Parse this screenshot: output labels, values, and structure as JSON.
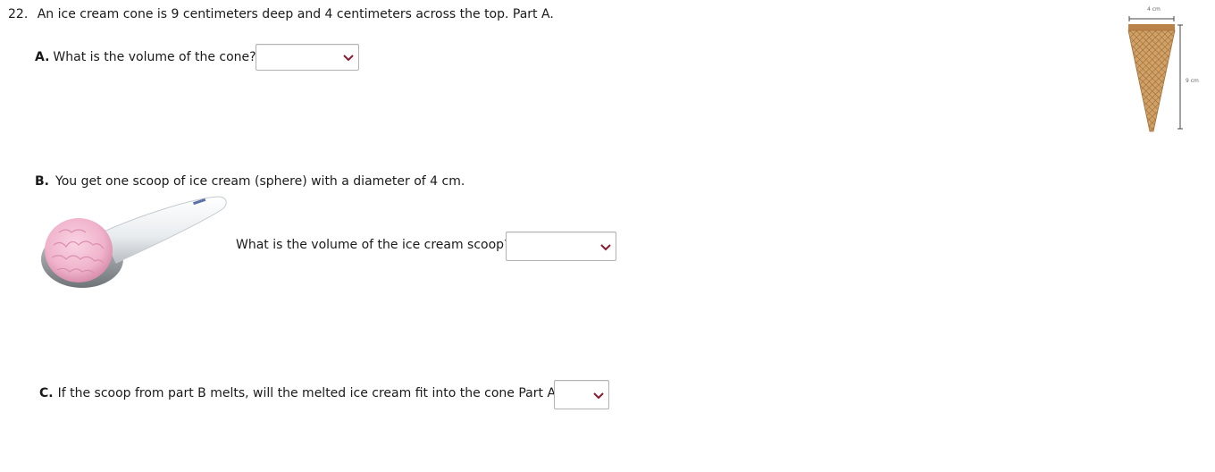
{
  "question": {
    "number": "22.",
    "text": "An ice cream cone is 9 centimeters deep and 4 centimeters across the top. Part A."
  },
  "part_a": {
    "letter": "A.",
    "prompt": "What is the volume of the cone?",
    "dropdown_value": ""
  },
  "part_b": {
    "letter": "B.",
    "prompt": "You get one scoop of ice cream (sphere) with a diameter of 4 cm.",
    "question": "What is the volume of the ice cream scoop?",
    "dropdown_value": ""
  },
  "part_c": {
    "letter": "C.",
    "prompt": "If the scoop from part B melts, will the melted ice cream fit into the cone Part A ?",
    "dropdown_value": ""
  },
  "cone_figure": {
    "top_label": "4 cm",
    "depth_label": "9 cm"
  },
  "icons": {
    "dropdown": "chevron-down-icon",
    "cone": "ice-cream-cone-image",
    "scoop": "ice-cream-scoop-image"
  },
  "colors": {
    "chevron": "#8b1a2e",
    "cone": "#c8955a",
    "ice_cream": "#f2b8cf"
  }
}
